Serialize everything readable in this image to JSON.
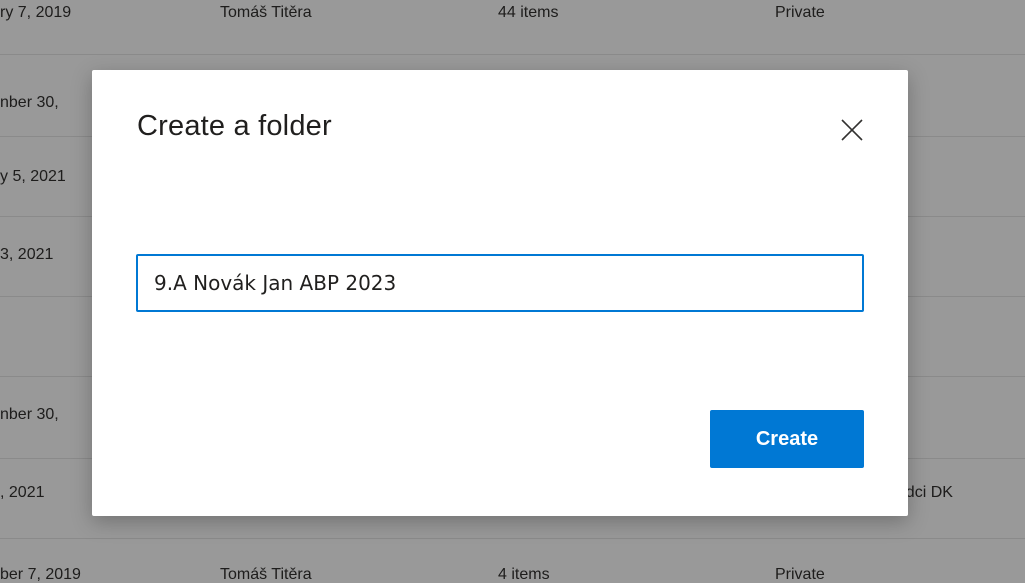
{
  "background_list": {
    "rows": [
      {
        "date": "ry 7, 2019",
        "owner": "Tomáš Titěra",
        "items": "44 items",
        "sharing": "Private"
      },
      {
        "date": "nber 30,",
        "owner": "",
        "items": "",
        "sharing": ""
      },
      {
        "date": "y 5, 2021",
        "owner": "",
        "items": "",
        "sharing": ""
      },
      {
        "date": "3, 2021",
        "owner": "",
        "items": "",
        "sharing": ""
      },
      {
        "date": "",
        "owner": "",
        "items": "",
        "sharing": ""
      },
      {
        "date": "nber 30,",
        "owner": "",
        "items": "",
        "sharing": ""
      },
      {
        "date": ", 2021",
        "owner": "",
        "items": "",
        "sharing": "ůvodci DK"
      },
      {
        "date": "ber 7, 2019",
        "owner": "Tomáš Titěra",
        "items": "4 items",
        "sharing": "Private"
      }
    ]
  },
  "dialog": {
    "title": "Create a folder",
    "close_icon": "close-icon",
    "folder_name_value": "9.A Novák Jan ABP 2023",
    "create_label": "Create"
  },
  "colors": {
    "accent": "#0078d4",
    "overlay": "rgba(0,0,0,0.40)"
  }
}
